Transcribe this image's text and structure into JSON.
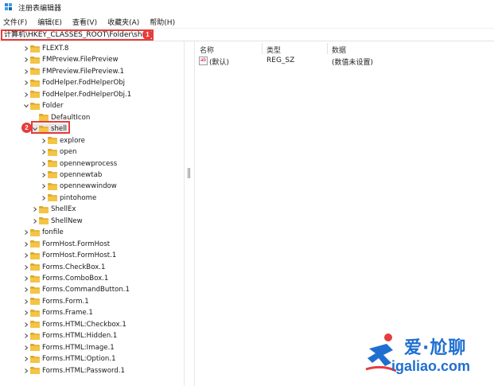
{
  "window": {
    "title": "注册表编辑器"
  },
  "menu": [
    "文件(F)",
    "编辑(E)",
    "查看(V)",
    "收藏夹(A)",
    "帮助(H)"
  ],
  "address": {
    "path": "计算机\\HKEY_CLASSES_ROOT\\Folder\\shell",
    "badge": "1"
  },
  "tree": {
    "rows": [
      {
        "label": "FLEXT.8",
        "level": 0,
        "expander": "collapsed"
      },
      {
        "label": "FMPreview.FilePreview",
        "level": 0,
        "expander": "collapsed"
      },
      {
        "label": "FMPreview.FilePreview.1",
        "level": 0,
        "expander": "collapsed"
      },
      {
        "label": "FodHelper.FodHelperObj",
        "level": 0,
        "expander": "collapsed"
      },
      {
        "label": "FodHelper.FodHelperObj.1",
        "level": 0,
        "expander": "collapsed"
      },
      {
        "label": "Folder",
        "level": 0,
        "expander": "expanded"
      },
      {
        "label": "DefaultIcon",
        "level": 1,
        "expander": "none"
      },
      {
        "label": "shell",
        "level": 1,
        "expander": "expanded",
        "selected": true
      },
      {
        "label": "explore",
        "level": 2,
        "expander": "collapsed"
      },
      {
        "label": "open",
        "level": 2,
        "expander": "collapsed"
      },
      {
        "label": "opennewprocess",
        "level": 2,
        "expander": "collapsed"
      },
      {
        "label": "opennewtab",
        "level": 2,
        "expander": "collapsed"
      },
      {
        "label": "opennewwindow",
        "level": 2,
        "expander": "collapsed"
      },
      {
        "label": "pintohome",
        "level": 2,
        "expander": "collapsed"
      },
      {
        "label": "ShellEx",
        "level": 1,
        "expander": "collapsed"
      },
      {
        "label": "ShellNew",
        "level": 1,
        "expander": "collapsed"
      },
      {
        "label": "fonfile",
        "level": 0,
        "expander": "collapsed"
      },
      {
        "label": "FormHost.FormHost",
        "level": 0,
        "expander": "collapsed"
      },
      {
        "label": "FormHost.FormHost.1",
        "level": 0,
        "expander": "collapsed"
      },
      {
        "label": "Forms.CheckBox.1",
        "level": 0,
        "expander": "collapsed"
      },
      {
        "label": "Forms.ComboBox.1",
        "level": 0,
        "expander": "collapsed"
      },
      {
        "label": "Forms.CommandButton.1",
        "level": 0,
        "expander": "collapsed"
      },
      {
        "label": "Forms.Form.1",
        "level": 0,
        "expander": "collapsed"
      },
      {
        "label": "Forms.Frame.1",
        "level": 0,
        "expander": "collapsed"
      },
      {
        "label": "Forms.HTML:Checkbox.1",
        "level": 0,
        "expander": "collapsed"
      },
      {
        "label": "Forms.HTML:Hidden.1",
        "level": 0,
        "expander": "collapsed"
      },
      {
        "label": "Forms.HTML:Image.1",
        "level": 0,
        "expander": "collapsed"
      },
      {
        "label": "Forms.HTML:Option.1",
        "level": 0,
        "expander": "collapsed"
      },
      {
        "label": "Forms.HTML:Password.1",
        "level": 0,
        "expander": "collapsed"
      }
    ],
    "selected_badge": "2"
  },
  "list": {
    "columns": [
      "名称",
      "类型",
      "数据"
    ],
    "rows": [
      {
        "icon": "string-value-icon",
        "icon_text": "ab",
        "name": "(默认)",
        "type": "REG_SZ",
        "data": "(数值未设置)"
      }
    ]
  },
  "watermark": {
    "line1": "爱·尬聊",
    "line2": "igaliao.com"
  },
  "colors": {
    "folder": "#f5c445",
    "folder_dark": "#dca72a",
    "highlight": "#e63d3d",
    "brand": "#1f6fd1",
    "selected_bg": "#e8e8e8"
  }
}
